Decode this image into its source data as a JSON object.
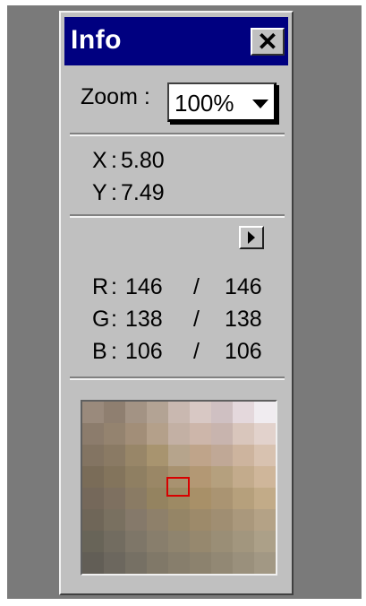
{
  "panel": {
    "title": "Info",
    "close_glyph": "✕"
  },
  "zoom": {
    "label": "Zoom :",
    "value": "100%"
  },
  "coordinates": {
    "x_label": "X",
    "x_value": "5.80",
    "y_label": "Y",
    "y_value": "7.49"
  },
  "color_values": {
    "r_label": "R",
    "r_value": "146",
    "r_value2": "146",
    "g_label": "G",
    "g_value": "138",
    "g_value2": "138",
    "b_label": "B",
    "b_value": "106",
    "b_value2": "106",
    "separator": "/"
  },
  "colors": {
    "titlebar": "#000080",
    "panel_bg": "#c0c0c0",
    "cursor_box": "#d80000"
  },
  "icons": {
    "close": "close-icon",
    "menu": "menu-arrow-icon",
    "dropdown": "chevron-down-icon"
  }
}
